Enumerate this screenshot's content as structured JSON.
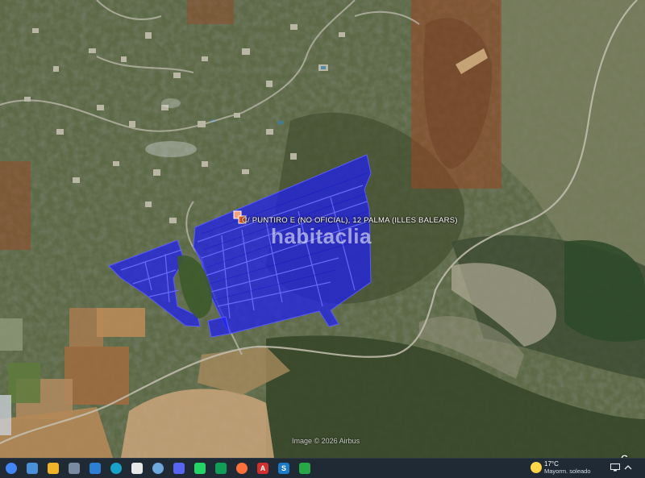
{
  "map": {
    "address_label": "C/ PUNTIRO E (NO OFICIAL), 12  PALMA (ILLES BALEARS)",
    "watermark": "habitaclia",
    "imagery_credit": "Image © 2026 Airbus",
    "corner_logo": "G",
    "parcel_color": "#1e1ef0",
    "highlight_color": "#8a3a22"
  },
  "taskbar": {
    "icons": [
      {
        "name": "start-chrome-icon",
        "label": "",
        "color": "#4285f4"
      },
      {
        "name": "file-icon",
        "label": "",
        "color": "#4a90d9"
      },
      {
        "name": "file-explorer-icon",
        "label": "",
        "color": "#f0b429"
      },
      {
        "name": "task-view-icon",
        "label": "",
        "color": "#7a8aa0"
      },
      {
        "name": "photos-icon",
        "label": "",
        "color": "#2d7fd3"
      },
      {
        "name": "edge-icon",
        "label": "",
        "color": "#1aa3c8"
      },
      {
        "name": "document-icon",
        "label": "",
        "color": "#e8e8e8"
      },
      {
        "name": "earth-icon",
        "label": "",
        "color": "#6fa8dc"
      },
      {
        "name": "discord-icon",
        "label": "",
        "color": "#5865f2"
      },
      {
        "name": "whatsapp-icon",
        "label": "",
        "color": "#25d366"
      },
      {
        "name": "app-c-icon",
        "label": "",
        "color": "#0f9d58"
      },
      {
        "name": "firefox-icon",
        "label": "",
        "color": "#ff7139"
      },
      {
        "name": "acrobat-icon",
        "label": "A",
        "color": "#d32f2f"
      },
      {
        "name": "sway-icon",
        "label": "S",
        "color": "#1d7ac9"
      },
      {
        "name": "spreadsheet-icon",
        "label": "",
        "color": "#27a745"
      }
    ],
    "weather": {
      "temperature": "17°C",
      "description": "Mayorm. soleado"
    }
  }
}
